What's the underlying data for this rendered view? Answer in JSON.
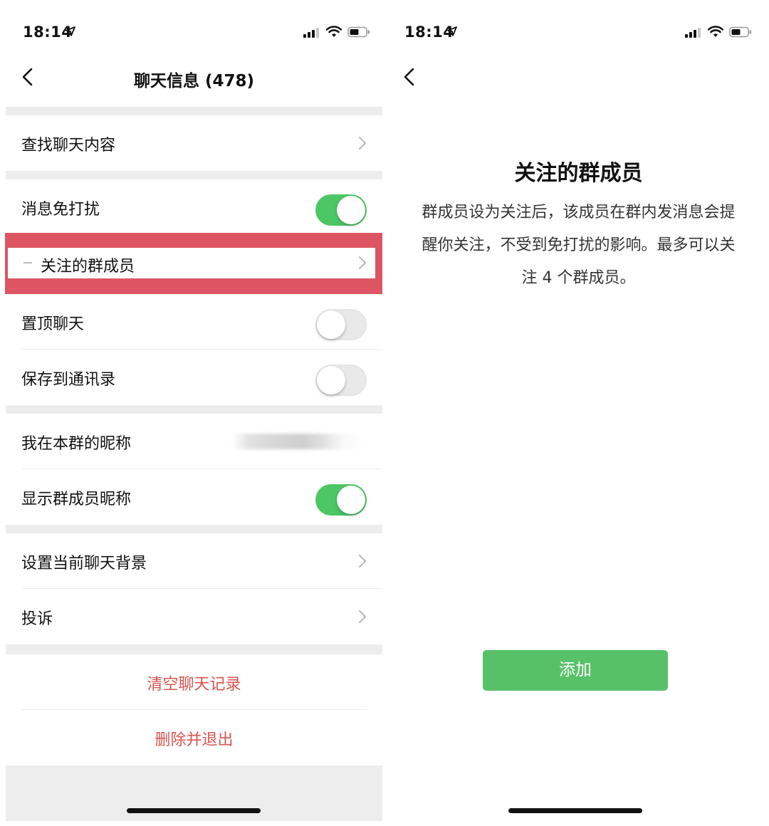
{
  "left_screen": {
    "status_bar": {
      "time": "18:14"
    },
    "nav": {
      "title": "聊天信息 (478)"
    },
    "rows": {
      "search_chat": "查找聊天内容",
      "mute": "消息免打扰",
      "mute_on": true,
      "focused_members": "关注的群成员",
      "sticky": "置顶聊天",
      "sticky_on": false,
      "save_contacts": "保存到通讯录",
      "save_contacts_on": false,
      "my_nickname": "我在本群的昵称",
      "show_nicknames": "显示群成员昵称",
      "show_nicknames_on": true,
      "set_background": "设置当前聊天背景",
      "report": "投诉"
    },
    "actions": {
      "clear_history": "清空聊天记录",
      "delete_exit": "删除并退出"
    }
  },
  "right_screen": {
    "status_bar": {
      "time": "18:14"
    },
    "title": "关注的群成员",
    "description": "群成员设为关注后，该成员在群内发消息会提醒你关注，不受到免打扰的影响。最多可以关注 4 个群成员。",
    "add_button": "添加"
  },
  "colors": {
    "toggle_on": "#4cc765",
    "highlight": "#dd5562",
    "danger_text": "#d9534f",
    "add_button": "#57c168",
    "group_gap": "#ededed"
  },
  "icons": [
    "location-arrow-icon",
    "signal-icon",
    "wifi-icon",
    "battery-icon",
    "back-chevron-icon",
    "chevron-right-icon"
  ]
}
